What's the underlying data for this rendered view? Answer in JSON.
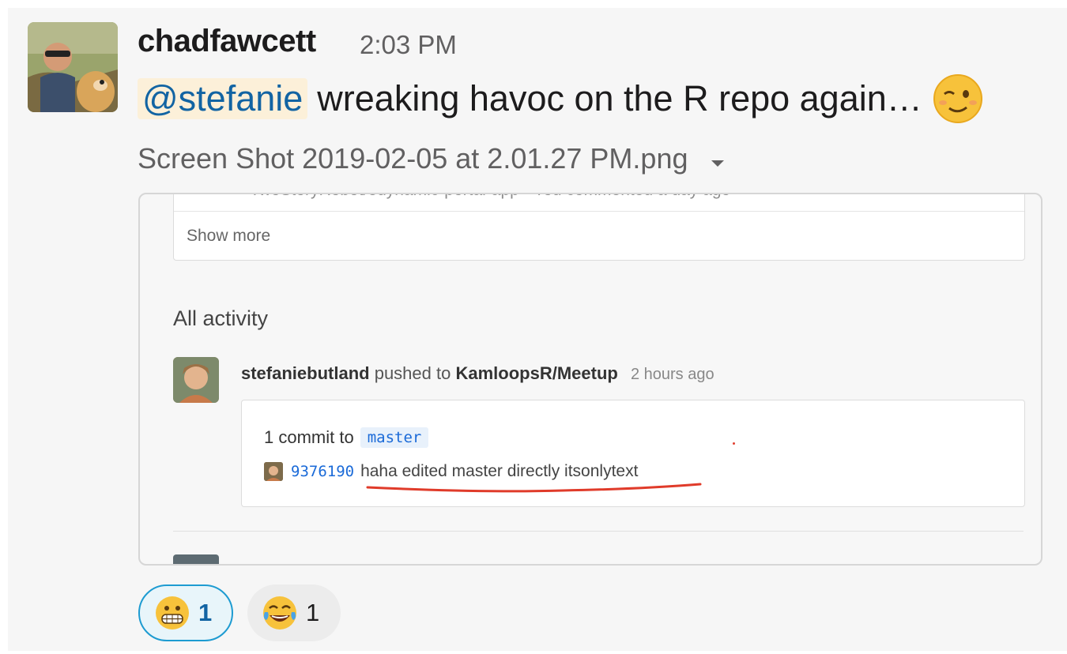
{
  "message": {
    "author": "chadfawcett",
    "time": "2:03 PM",
    "mention": "@stefanie",
    "text": "wreaking havoc on the R repo again…",
    "emoji": "wink-emoji"
  },
  "attachment": {
    "file_name": "Screen Shot 2019-02-05 at 2.01.27 PM.png",
    "caret_icon": "caret-down-icon"
  },
  "screenshot": {
    "cut_text": "TwoStoryRobot/edynamic-portal-app  ·  You commented a day ago",
    "show_more": "Show more",
    "section_title": "All activity",
    "activity": {
      "user": "stefaniebutland",
      "action": "pushed to",
      "repo": "KamloopsR/Meetup",
      "time": "2 hours ago",
      "commit_summary_prefix": "1 commit to",
      "branch": "master",
      "sha": "9376190",
      "commit_message": "haha edited master directly itsonlytext"
    }
  },
  "reactions": [
    {
      "emoji": "grimacing-emoji",
      "count": "1",
      "active": true
    },
    {
      "emoji": "joy-emoji",
      "count": "1",
      "active": false
    }
  ],
  "colors": {
    "mention_bg": "#fcf0d9",
    "mention_text": "#1264a3",
    "link_blue": "#1a6ad8",
    "underline_red": "#e03b2a",
    "active_reaction_border": "#1d9bd1"
  }
}
